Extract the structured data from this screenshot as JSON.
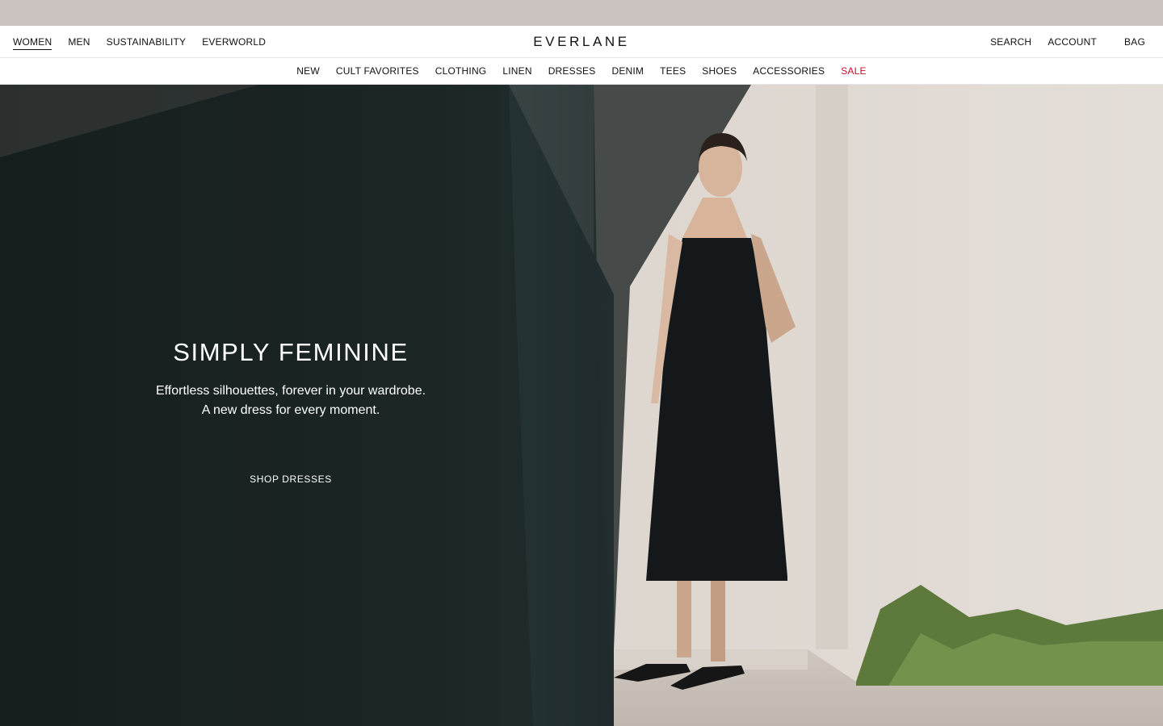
{
  "top_nav": {
    "left": [
      "WOMEN",
      "MEN",
      "SUSTAINABILITY",
      "EVERWORLD"
    ],
    "logo": "EVERLANE",
    "right": {
      "search": "SEARCH",
      "account": "ACCOUNT",
      "bag": "BAG"
    }
  },
  "category_nav": [
    "NEW",
    "CULT FAVORITES",
    "CLOTHING",
    "LINEN",
    "DRESSES",
    "DENIM",
    "TEES",
    "SHOES",
    "ACCESSORIES",
    "SALE"
  ],
  "hero": {
    "title": "SIMPLY FEMININE",
    "subtitle_line1": "Effortless silhouettes, forever in your wardrobe.",
    "subtitle_line2": "A new dress for every moment.",
    "cta": "SHOP DRESSES"
  },
  "colors": {
    "announcement_bar": "#cbc3c0",
    "sale": "#c8102e",
    "hero_shadow": "#1c2424",
    "wall": "#dcd5cf"
  }
}
